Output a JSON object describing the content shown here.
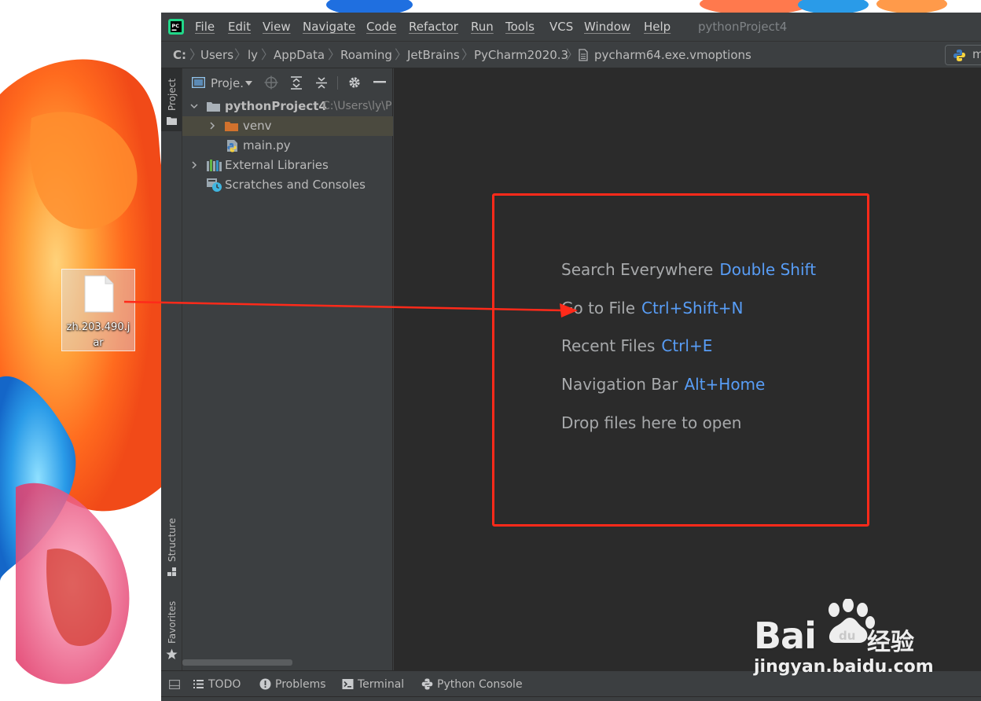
{
  "desktop": {
    "file_icon_label": "zh.203.490.jar"
  },
  "menubar": {
    "items": [
      "File",
      "Edit",
      "View",
      "Navigate",
      "Code",
      "Refactor",
      "Run",
      "Tools",
      "VCS",
      "Window",
      "Help"
    ],
    "window_title": "pythonProject4"
  },
  "breadcrumb": {
    "items": [
      "C:",
      "Users",
      "ly",
      "AppData",
      "Roaming",
      "JetBrains",
      "PyCharm2020.3",
      "pycharm64.exe.vmoptions"
    ],
    "run_config_label": "m"
  },
  "stripe": {
    "project": "Project",
    "structure": "Structure",
    "favorites": "Favorites"
  },
  "project_panel": {
    "title": "Proje.",
    "tree": {
      "root": "pythonProject4",
      "root_path": "C:\\Users\\ly\\P",
      "venv": "venv",
      "main": "main.py",
      "external": "External Libraries",
      "scratches": "Scratches and Consoles"
    }
  },
  "editor": {
    "hints": [
      {
        "label": "Search Everywhere",
        "shortcut": "Double Shift"
      },
      {
        "label": "Go to File",
        "shortcut": "Ctrl+Shift+N"
      },
      {
        "label": "Recent Files",
        "shortcut": "Ctrl+E"
      },
      {
        "label": "Navigation Bar",
        "shortcut": "Alt+Home"
      },
      {
        "label": "Drop files here to open",
        "shortcut": ""
      }
    ]
  },
  "bottom_tools": {
    "todo": "TODO",
    "problems": "Problems",
    "terminal": "Terminal",
    "python_console": "Python Console"
  },
  "watermark": {
    "brand": "Bai",
    "brand_cn": "经验",
    "url": "jingyan.baidu.com"
  },
  "colors": {
    "shortcut_blue": "#589df6",
    "annotation_red": "#ff2a1a",
    "editor_bg": "#2b2b2b",
    "panel_bg": "#3c3f41"
  }
}
